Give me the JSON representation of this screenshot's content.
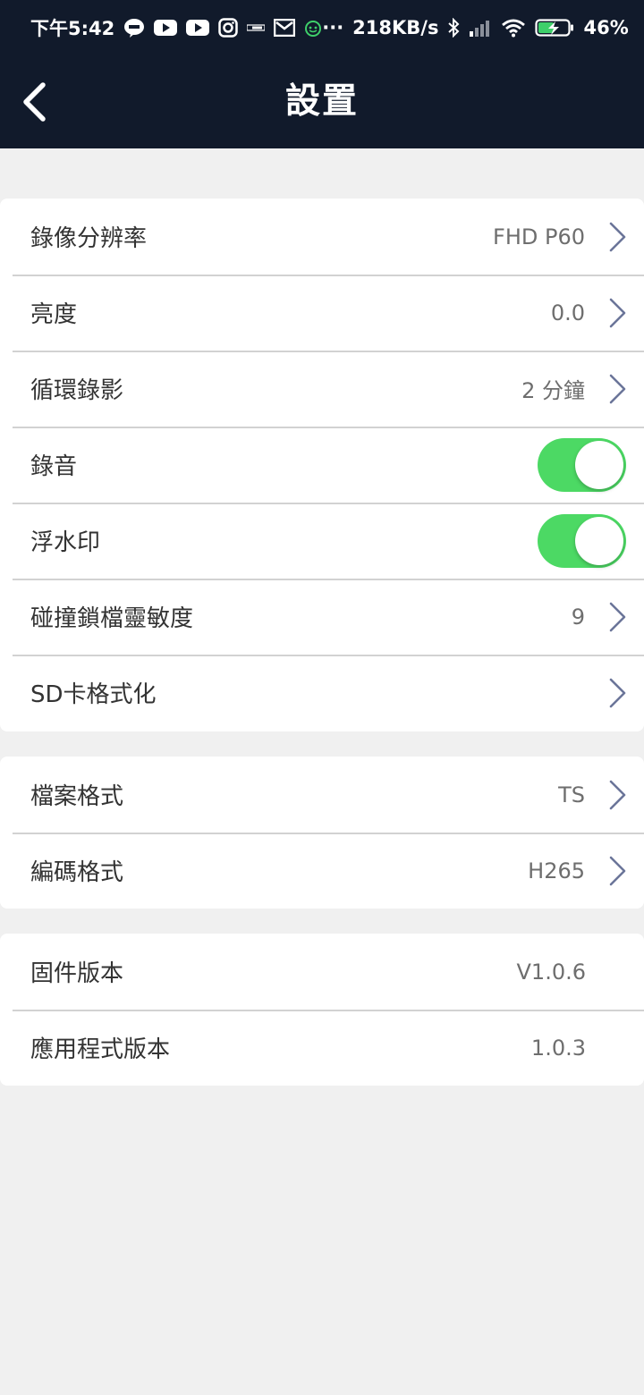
{
  "status_bar": {
    "time": "下午5:42",
    "net_speed": "218KB/s",
    "battery": "46%",
    "more": "···",
    "icons": [
      "line-icon",
      "youtube-icon",
      "youtube-icon",
      "instagram-icon",
      "ex-icon",
      "gmail-icon",
      "android-icon",
      "bluetooth-icon",
      "signal-icon",
      "wifi-icon",
      "battery-charging-icon"
    ]
  },
  "header": {
    "title": "設置",
    "back_icon": "chevron-left-icon"
  },
  "colors": {
    "header_bg": "#111a2b",
    "toggle_on": "#4cd964",
    "chevron": "#6b7599",
    "page_bg": "#f0f0f0"
  },
  "group1": {
    "rows": [
      {
        "label": "錄像分辨率",
        "value": "FHD P60"
      },
      {
        "label": "亮度",
        "value": "0.0"
      },
      {
        "label": "循環錄影",
        "value": "2 分鐘"
      },
      {
        "label": "錄音",
        "toggle": true
      },
      {
        "label": "浮水印",
        "toggle": true
      },
      {
        "label": "碰撞鎖檔靈敏度",
        "value": "9"
      },
      {
        "label": "SD卡格式化"
      }
    ]
  },
  "group2": {
    "rows": [
      {
        "label": "檔案格式",
        "value": "TS"
      },
      {
        "label": "編碼格式",
        "value": "H265"
      }
    ]
  },
  "group3": {
    "rows": [
      {
        "label": "固件版本",
        "value": "V1.0.6"
      },
      {
        "label": "應用程式版本",
        "value": "1.0.3"
      }
    ]
  }
}
